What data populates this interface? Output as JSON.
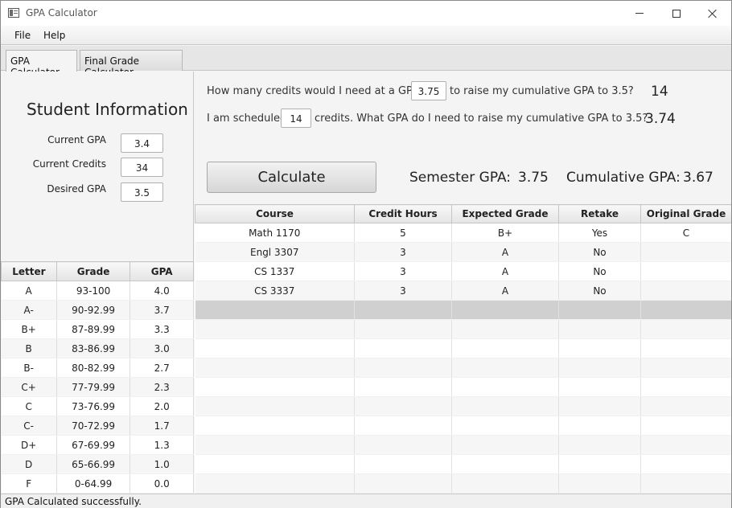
{
  "window": {
    "title": "GPA Calculator"
  },
  "menu": {
    "file": "File",
    "help": "Help"
  },
  "tabs": [
    "GPA Calculator",
    "Final Grade Calculator"
  ],
  "student_info": {
    "title": "Student Information",
    "fields": [
      {
        "label": "Current GPA",
        "value": "3.4"
      },
      {
        "label": "Current Credits",
        "value": "34"
      },
      {
        "label": "Desired GPA",
        "value": "3.5"
      }
    ]
  },
  "grade_scale": {
    "headers": [
      "Letter",
      "Grade",
      "GPA"
    ],
    "rows": [
      [
        "A",
        "93-100",
        "4.0"
      ],
      [
        "A-",
        "90-92.99",
        "3.7"
      ],
      [
        "B+",
        "87-89.99",
        "3.3"
      ],
      [
        "B",
        "83-86.99",
        "3.0"
      ],
      [
        "B-",
        "80-82.99",
        "2.7"
      ],
      [
        "C+",
        "77-79.99",
        "2.3"
      ],
      [
        "C",
        "73-76.99",
        "2.0"
      ],
      [
        "C-",
        "70-72.99",
        "1.7"
      ],
      [
        "D+",
        "67-69.99",
        "1.3"
      ],
      [
        "D",
        "65-66.99",
        "1.0"
      ],
      [
        "F",
        "0-64.99",
        "0.0"
      ]
    ]
  },
  "questions": {
    "q1_prefix": "How many credits would I need at a GPA of",
    "q1_input": "3.75",
    "q1_suffix": "to raise my cumulative GPA to 3.5?",
    "q1_result": "14",
    "q2_prefix": "I am scheduled",
    "q2_input": "14",
    "q2_suffix": "credits. What GPA do I need to raise my cumulative GPA to 3.5?",
    "q2_result": "3.74"
  },
  "calculate_label": "Calculate",
  "results": {
    "semester_label": "Semester GPA:",
    "semester_value": "3.75",
    "cumulative_label": "Cumulative GPA:",
    "cumulative_value": "3.67"
  },
  "courses": {
    "headers": [
      "Course",
      "Credit Hours",
      "Expected Grade",
      "Retake",
      "Original Grade"
    ],
    "rows": [
      [
        "Math 1170",
        "5",
        "B+",
        "Yes",
        "C"
      ],
      [
        "Engl 3307",
        "3",
        "A",
        "No",
        ""
      ],
      [
        "CS 1337",
        "3",
        "A",
        "No",
        ""
      ],
      [
        "CS 3337",
        "3",
        "A",
        "No",
        ""
      ]
    ]
  },
  "status": "GPA Calculated successfully."
}
